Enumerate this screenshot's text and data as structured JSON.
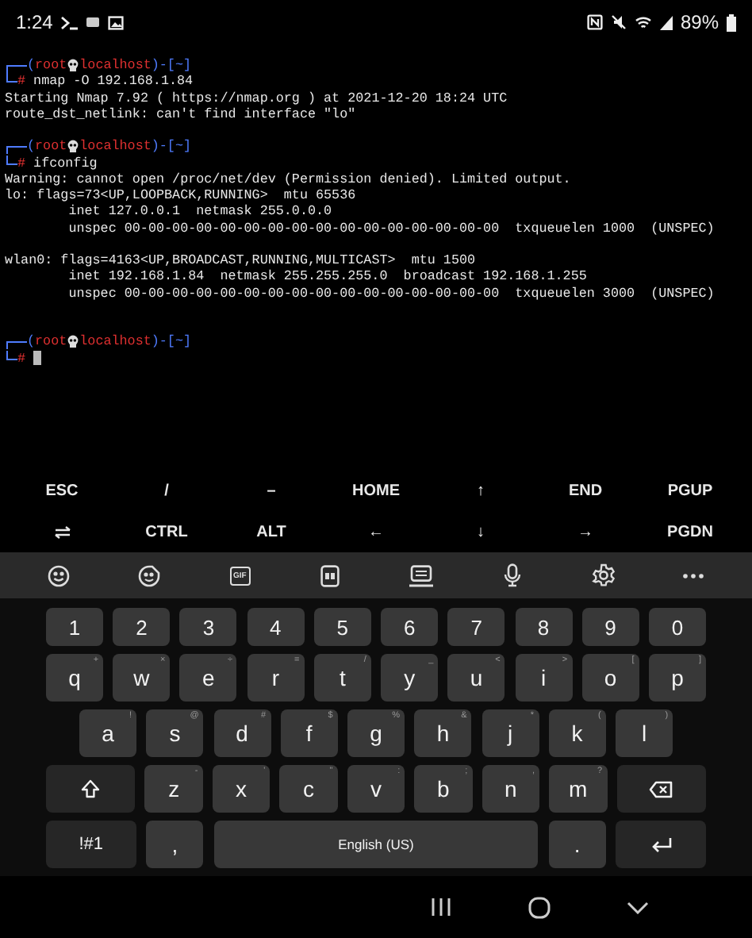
{
  "status_bar": {
    "time": "1:24",
    "battery": "89%"
  },
  "terminal": {
    "lines": [
      {
        "kind": "prompt",
        "open": "(",
        "user": "root",
        "host": "localhost",
        "mid": ")-[",
        "path": "~",
        "close": "]"
      },
      {
        "kind": "command",
        "symbol": "#",
        "text": "nmap -O 192.168.1.84"
      },
      {
        "kind": "output",
        "text": "Starting Nmap 7.92 ( https://nmap.org ) at 2021-12-20 18:24 UTC"
      },
      {
        "kind": "output",
        "text": "route_dst_netlink: can't find interface \"lo\""
      },
      {
        "kind": "blank"
      },
      {
        "kind": "prompt",
        "open": "(",
        "user": "root",
        "host": "localhost",
        "mid": ")-[",
        "path": "~",
        "close": "]"
      },
      {
        "kind": "command",
        "symbol": "#",
        "text": "ifconfig"
      },
      {
        "kind": "output",
        "text": "Warning: cannot open /proc/net/dev (Permission denied). Limited output."
      },
      {
        "kind": "output",
        "text": "lo: flags=73<UP,LOOPBACK,RUNNING>  mtu 65536"
      },
      {
        "kind": "detail",
        "text": "inet 127.0.0.1  netmask 255.0.0.0"
      },
      {
        "kind": "detail",
        "text": "unspec 00-00-00-00-00-00-00-00-00-00-00-00-00-00-00-00  txqueuelen 1000  (UNSPEC)"
      },
      {
        "kind": "blank"
      },
      {
        "kind": "output",
        "text": "wlan0: flags=4163<UP,BROADCAST,RUNNING,MULTICAST>  mtu 1500"
      },
      {
        "kind": "detail",
        "text": "inet 192.168.1.84  netmask 255.255.255.0  broadcast 192.168.1.255"
      },
      {
        "kind": "detail",
        "text": "unspec 00-00-00-00-00-00-00-00-00-00-00-00-00-00-00-00  txqueuelen 3000  (UNSPEC)"
      },
      {
        "kind": "blank"
      },
      {
        "kind": "blank"
      },
      {
        "kind": "prompt",
        "open": "(",
        "user": "root",
        "host": "localhost",
        "mid": ")-[",
        "path": "~",
        "close": "]"
      },
      {
        "kind": "input",
        "symbol": "#"
      }
    ]
  },
  "extra_keys": [
    [
      {
        "kind": "text",
        "label": "ESC"
      },
      {
        "kind": "text",
        "label": "/"
      },
      {
        "kind": "text",
        "label": "–"
      },
      {
        "kind": "text",
        "label": "HOME"
      },
      {
        "kind": "text",
        "label": "↑"
      },
      {
        "kind": "text",
        "label": "END"
      },
      {
        "kind": "text",
        "label": "PGUP"
      }
    ],
    [
      {
        "kind": "icon"
      },
      {
        "kind": "text",
        "label": "CTRL"
      },
      {
        "kind": "text",
        "label": "ALT"
      },
      {
        "kind": "text",
        "label": "←"
      },
      {
        "kind": "text",
        "label": "↓"
      },
      {
        "kind": "text",
        "label": "→"
      },
      {
        "kind": "text",
        "label": "PGDN"
      }
    ]
  ],
  "toolbar": {
    "gif_label": "GIF"
  },
  "keyboard": [
    [
      {
        "kind": "digit",
        "label": "1"
      },
      {
        "kind": "digit",
        "label": "2"
      },
      {
        "kind": "digit",
        "label": "3"
      },
      {
        "kind": "digit",
        "label": "4"
      },
      {
        "kind": "digit",
        "label": "5"
      },
      {
        "kind": "digit",
        "label": "6"
      },
      {
        "kind": "digit",
        "label": "7"
      },
      {
        "kind": "digit",
        "label": "8"
      },
      {
        "kind": "digit",
        "label": "9"
      },
      {
        "kind": "digit",
        "label": "0"
      }
    ],
    [
      {
        "kind": "char",
        "label": "q",
        "hint": "+"
      },
      {
        "kind": "char",
        "label": "w",
        "hint": "×"
      },
      {
        "kind": "char",
        "label": "e",
        "hint": "÷"
      },
      {
        "kind": "char",
        "label": "r",
        "hint": "="
      },
      {
        "kind": "char",
        "label": "t",
        "hint": "/"
      },
      {
        "kind": "char",
        "label": "y",
        "hint": "_"
      },
      {
        "kind": "char",
        "label": "u",
        "hint": "<"
      },
      {
        "kind": "char",
        "label": "i",
        "hint": ">"
      },
      {
        "kind": "char",
        "label": "o",
        "hint": "["
      },
      {
        "kind": "char",
        "label": "p",
        "hint": "]"
      }
    ],
    [
      {
        "kind": "char",
        "label": "a",
        "hint": "!"
      },
      {
        "kind": "char",
        "label": "s",
        "hint": "@"
      },
      {
        "kind": "char",
        "label": "d",
        "hint": "#"
      },
      {
        "kind": "char",
        "label": "f",
        "hint": "$"
      },
      {
        "kind": "char",
        "label": "g",
        "hint": "%"
      },
      {
        "kind": "char",
        "label": "h",
        "hint": "&"
      },
      {
        "kind": "char",
        "label": "j",
        "hint": "*"
      },
      {
        "kind": "char",
        "label": "k",
        "hint": "("
      },
      {
        "kind": "char",
        "label": "l",
        "hint": ")"
      }
    ],
    [
      {
        "kind": "shift"
      },
      {
        "kind": "char",
        "label": "z",
        "hint": "-"
      },
      {
        "kind": "char",
        "label": "x",
        "hint": "'"
      },
      {
        "kind": "char",
        "label": "c",
        "hint": "\""
      },
      {
        "kind": "char",
        "label": "v",
        "hint": ":"
      },
      {
        "kind": "char",
        "label": "b",
        "hint": ";"
      },
      {
        "kind": "char",
        "label": "n",
        "hint": ","
      },
      {
        "kind": "char",
        "label": "m",
        "hint": "?"
      },
      {
        "kind": "backspace"
      }
    ],
    [
      {
        "kind": "symbols",
        "label": "!#1"
      },
      {
        "kind": "char",
        "label": ","
      },
      {
        "kind": "space",
        "label": "English (US)"
      },
      {
        "kind": "char",
        "label": "."
      },
      {
        "kind": "enter"
      }
    ]
  ]
}
